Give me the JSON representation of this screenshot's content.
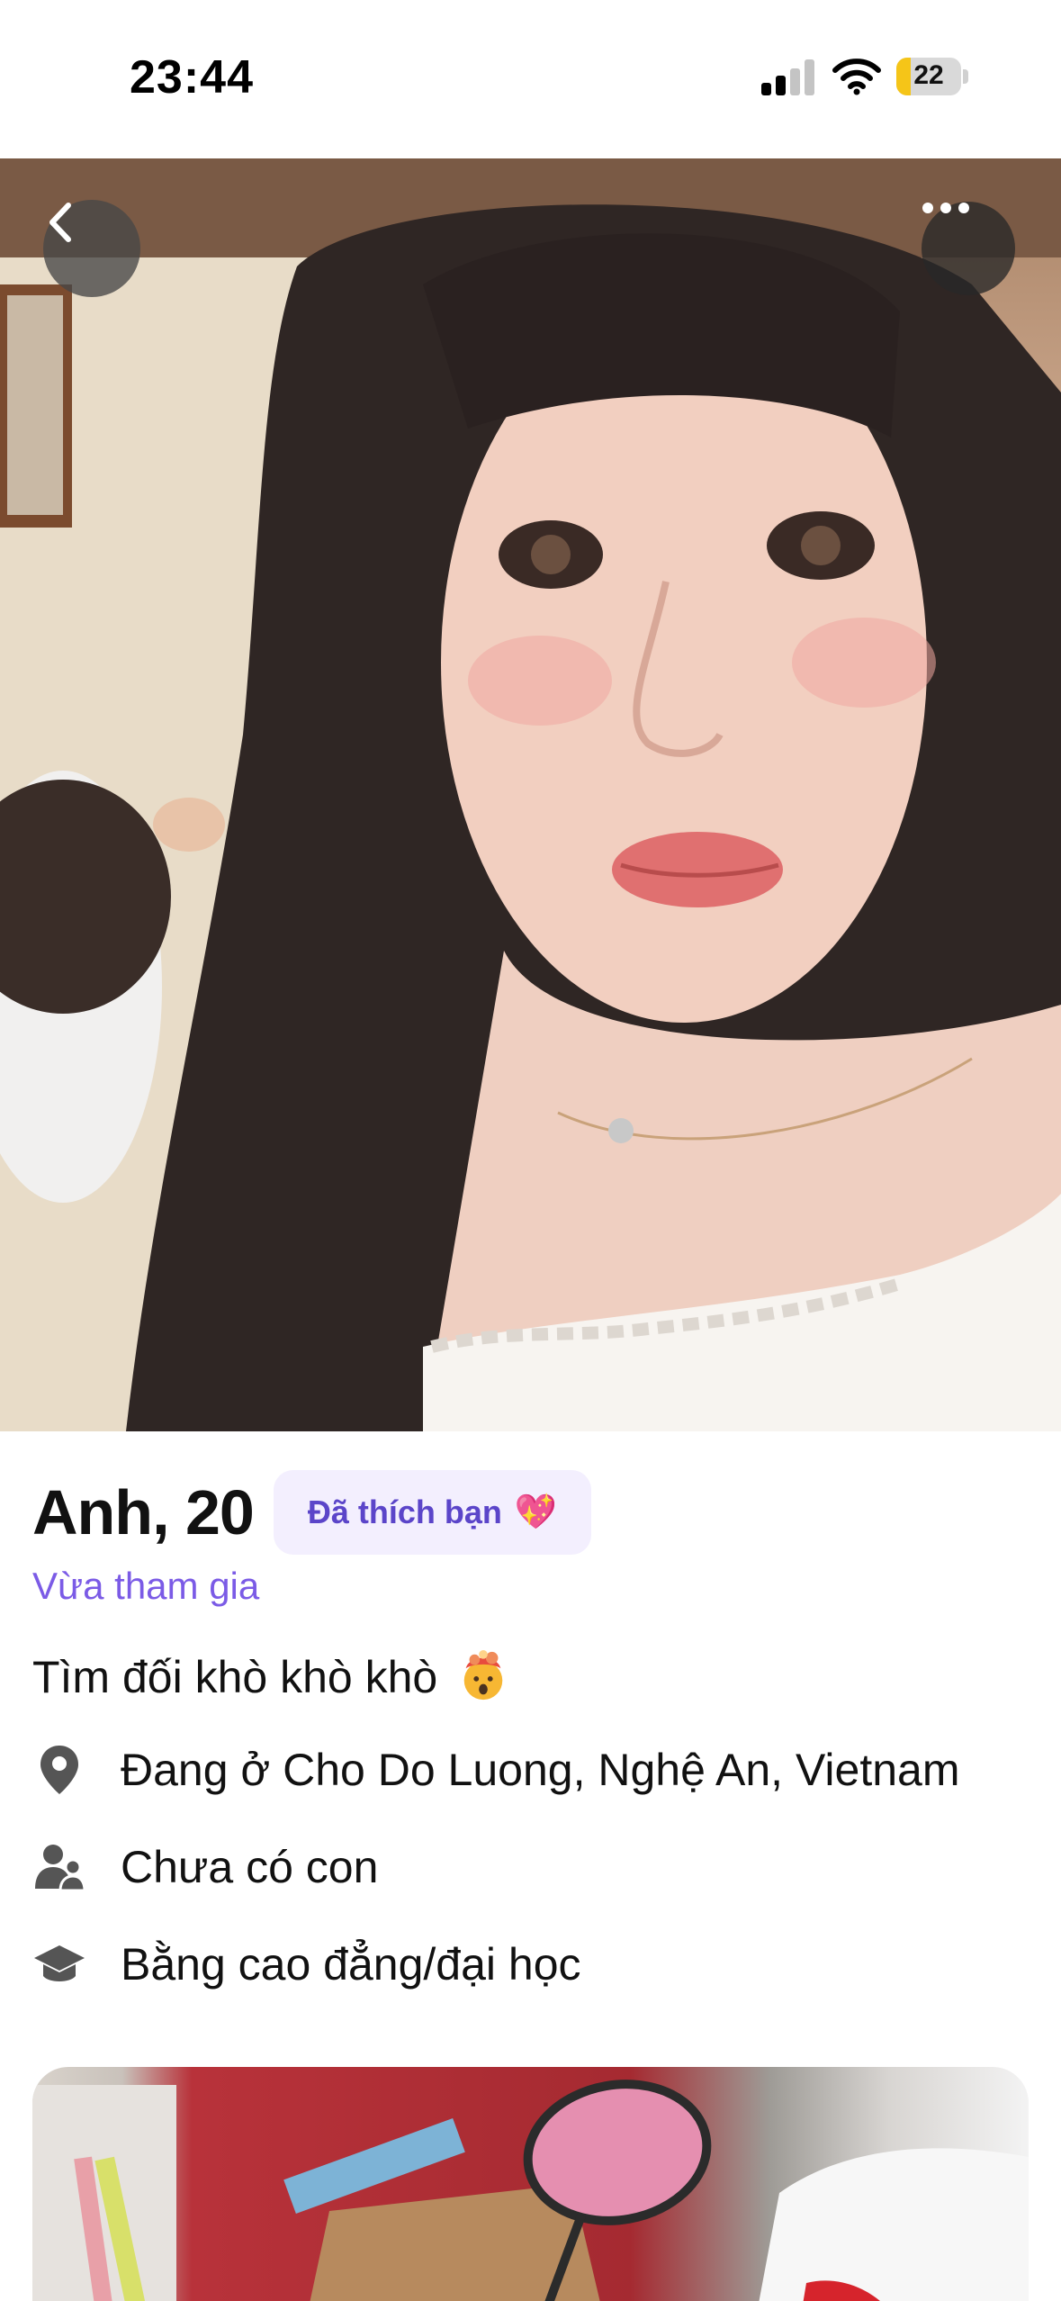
{
  "status_bar": {
    "time": "23:44",
    "battery_level": "22",
    "battery_fraction": 0.22
  },
  "photo_overlay": {
    "back_icon": "chevron-left-icon",
    "more_icon": "ellipsis-icon"
  },
  "profile": {
    "name_age": "Anh, 20",
    "liked_badge": "Đã thích bạn",
    "liked_badge_icon": "sparkling-heart-icon",
    "joined": "Vừa tham gia",
    "bio": "Tìm đối khò khò khò",
    "bio_icon": "exploding-head-emoji",
    "location": "Đang ở Cho Do Luong, Nghệ An, Vietnam",
    "children": "Chưa có con",
    "education": "Bằng cao đẳng/đại học"
  },
  "colors": {
    "accent": "#7b5be6",
    "badge_bg": "#f3effe",
    "badge_text": "#5b45c9",
    "battery_fill": "#f5c518"
  }
}
